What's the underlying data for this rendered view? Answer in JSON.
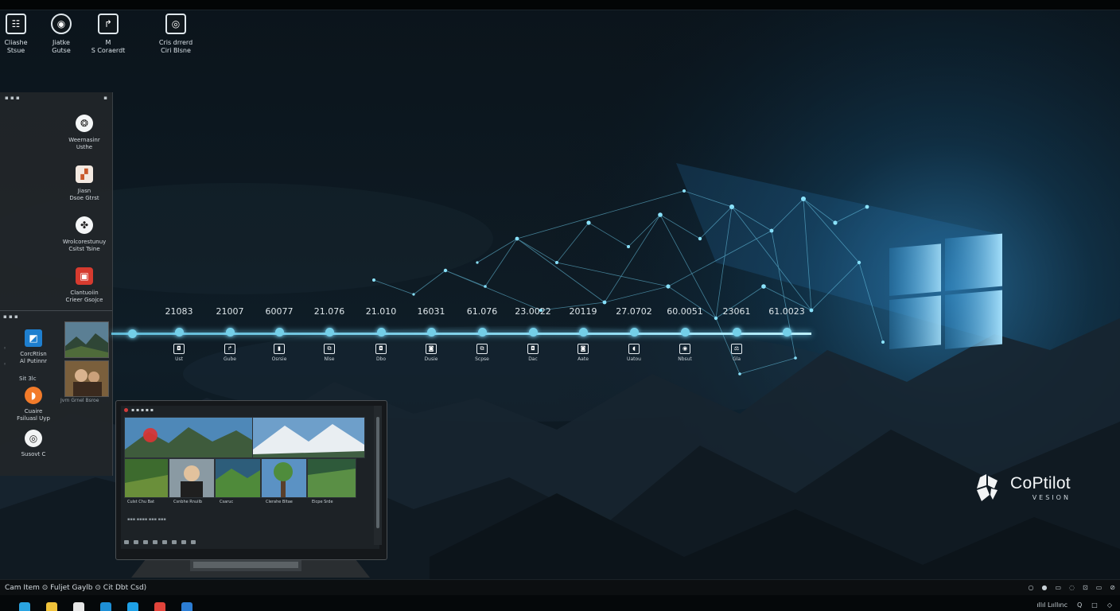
{
  "desktop_icons": [
    {
      "label": "Cliashe\nStsue",
      "icon": "list-icon",
      "glyph": "☷"
    },
    {
      "label": "Jiatke\nGutse",
      "icon": "record-icon",
      "glyph": "◉"
    },
    {
      "label": "M\nS Coraerdt",
      "icon": "arrow-doc-icon",
      "glyph": "↱"
    },
    {
      "label": "Cris drrerd\nCiri Blsne",
      "icon": "location-icon",
      "glyph": "◎"
    }
  ],
  "left_panel": {
    "header_left": "▪ ▪ ▪",
    "header_right": "▪",
    "apps": [
      {
        "label": "Weernasinr\nUsthe",
        "icon": "chat-icon",
        "glyph": "❂"
      },
      {
        "label": "Jiasn\nDsoe Gtrst",
        "icon": "phone-icon",
        "glyph": "▞"
      },
      {
        "label": "Wrolcorestunuy\nCsitst Tsine",
        "icon": "share-icon",
        "glyph": "✤"
      },
      {
        "label": "Clantuoiin\nCrieer Gsojce",
        "icon": "office-icon",
        "glyph": "▣"
      }
    ],
    "sub_header": "▪ ▪ ▪",
    "side_items": [
      "◦",
      "◦",
      "◦"
    ],
    "mini_apps": [
      {
        "label": "CorcRtisn\nAl Putinnr",
        "icon": "window-icon",
        "glyph": "◩",
        "color": "#1e7fcf"
      },
      {
        "label": "Cuaire\nFsiluasl Uyp",
        "icon": "camera-icon",
        "glyph": "◗",
        "color": "#f27b2a"
      },
      {
        "label": "Susovt C",
        "icon": "disc-icon",
        "glyph": "◎",
        "color": "#f2f4f5"
      }
    ],
    "selected_label": "Sit 3lc",
    "thumb_caption": "Jvrn Grnel Bsroe"
  },
  "timeline": [
    {
      "date": "21083",
      "label": "Ust",
      "glyph": "◘"
    },
    {
      "date": "21007",
      "label": "Gube",
      "glyph": "↱"
    },
    {
      "date": "60077",
      "label": "Osrsie",
      "glyph": "▮"
    },
    {
      "date": "21.076",
      "label": "Nlse",
      "glyph": "⧉"
    },
    {
      "date": "21.010",
      "label": "Dbo",
      "glyph": "◘"
    },
    {
      "date": "16031",
      "label": "Dusie",
      "glyph": "◙"
    },
    {
      "date": "61.076",
      "label": "Scpse",
      "glyph": "⧉"
    },
    {
      "date": "23.0022",
      "label": "Dac",
      "glyph": "◘"
    },
    {
      "date": "20119",
      "label": "Aate",
      "glyph": "◙"
    },
    {
      "date": "27.0702",
      "label": "Uatou",
      "glyph": "◖"
    },
    {
      "date": "60.0051",
      "label": "Nbsut",
      "glyph": "◉"
    },
    {
      "date": "23061",
      "label": "Gla",
      "glyph": "⚖"
    },
    {
      "date": "61.0023",
      "label": "",
      "glyph": ""
    }
  ],
  "laptop": {
    "title": "▪ ▪ ▪ ▪ ▪",
    "captions": [
      "Culst Chu Bat",
      "Csnbhe Rnuilb",
      "Csaruc",
      "Clerahe Bltae",
      "Eicpe Srde"
    ],
    "status_line": "▪▪▪ ▪▪▪▪ ▪▪▪ ▪▪▪"
  },
  "brand": {
    "name": "CoPtilot",
    "subtitle": "VESION"
  },
  "status_bar": {
    "left_text": "Cam Item  ⊙ Fuljet Gaylb  ⊙ Cit Dbt Csd)",
    "right_items": [
      "○",
      "●",
      "▭",
      "◌",
      "⊡",
      "▭",
      "⊘"
    ]
  },
  "taskbar": {
    "icons": [
      {
        "name": "windows-icon",
        "color": "#2aa3e0"
      },
      {
        "name": "chrome-icon",
        "color": "#f0c23a"
      },
      {
        "name": "files-icon",
        "color": "#e6e6e6"
      },
      {
        "name": "browser-icon",
        "color": "#1e8fd6"
      },
      {
        "name": "skype-icon",
        "color": "#1ea0e6"
      },
      {
        "name": "office-icon",
        "color": "#e2443b"
      },
      {
        "name": "mail-icon",
        "color": "#2c7dd4"
      }
    ],
    "right_text": [
      "ıllıl Lııllınc",
      "Q",
      "□",
      "◇"
    ]
  },
  "colors": {
    "accent": "#74cfe8",
    "glow": "#4fb2ff",
    "panel": "#222629"
  }
}
